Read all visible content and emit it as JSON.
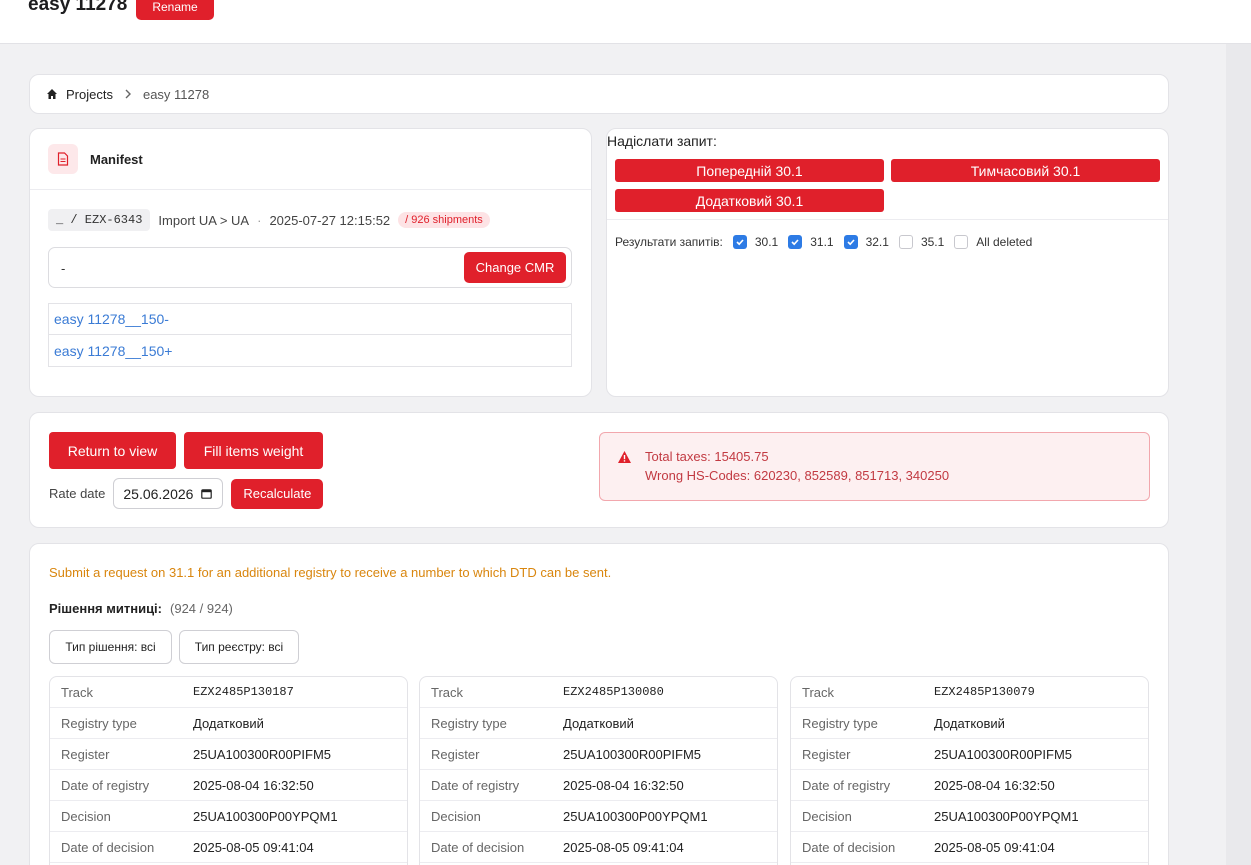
{
  "header": {
    "title": "easy 11278",
    "rename_label": "Rename"
  },
  "breadcrumb": {
    "home_label": "Projects",
    "current": "easy 11278"
  },
  "manifest": {
    "title": "Manifest",
    "code": "_ / EZX-6343",
    "route": "Import UA > UA",
    "datetime": "2025-07-27 12:15:52",
    "shipments": "/ 926 shipments",
    "cmr_value": "-",
    "change_cmr_label": "Change CMR",
    "links": [
      "easy 11278__150-",
      "easy 11278__150+"
    ]
  },
  "request": {
    "title": "Надіслати запит:",
    "buttons": [
      "Попередній 30.1",
      "Тимчасовий 30.1",
      "Додатковий 30.1"
    ],
    "results_label": "Результати запитів:",
    "options": [
      {
        "label": "30.1",
        "checked": true
      },
      {
        "label": "31.1",
        "checked": true
      },
      {
        "label": "32.1",
        "checked": true
      },
      {
        "label": "35.1",
        "checked": false
      },
      {
        "label": "All deleted",
        "checked": false
      }
    ]
  },
  "actions": {
    "return_label": "Return to view",
    "fill_label": "Fill items weight",
    "rate_label": "Rate date",
    "rate_value": "25.06.2026",
    "recalc_label": "Recalculate",
    "alert_line1": "Total taxes: 15405.75",
    "alert_line2": "Wrong HS-Codes: 620230, 852589, 851713, 340250"
  },
  "decisions": {
    "notice": "Submit a request on 31.1 for an additional registry to receive a number to which DTD can be sent.",
    "label": "Рішення митниці:",
    "count": "(924 / 924)",
    "filter_type": "Тип рішення: всі",
    "filter_registry": "Тип реєстру: всі",
    "field_labels": [
      "Track",
      "Registry type",
      "Register",
      "Date of registry",
      "Decision",
      "Date of decision",
      ""
    ],
    "records": [
      {
        "track": "EZX2485P130187",
        "registry_type": "Додатковий",
        "register": "25UA100300R00PIFM5",
        "date_registry": "2025-08-04 16:32:50",
        "decision": "25UA100300P00YPQM1",
        "date_decision": "2025-08-05 09:41:04"
      },
      {
        "track": "EZX2485P130080",
        "registry_type": "Додатковий",
        "register": "25UA100300R00PIFM5",
        "date_registry": "2025-08-04 16:32:50",
        "decision": "25UA100300P00YPQM1",
        "date_decision": "2025-08-05 09:41:04"
      },
      {
        "track": "EZX2485P130079",
        "registry_type": "Додатковий",
        "register": "25UA100300R00PIFM5",
        "date_registry": "2025-08-04 16:32:50",
        "decision": "25UA100300P00YPQM1",
        "date_decision": "2025-08-05 09:41:04"
      }
    ]
  },
  "colors": {
    "accent": "#e0202b",
    "link": "#3a7bd5",
    "checkbox": "#2d7be5",
    "notice": "#d9860e"
  }
}
